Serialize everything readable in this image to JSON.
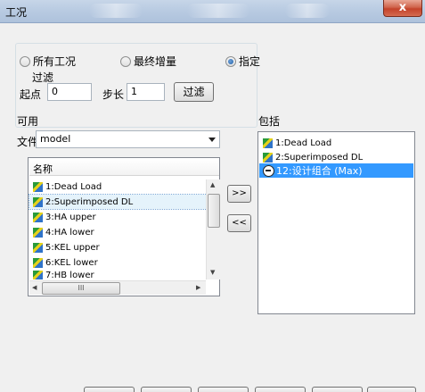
{
  "window": {
    "title": "工况",
    "close_label": "x"
  },
  "scope": {
    "options": [
      "所有工况",
      "最终增量",
      "指定"
    ],
    "selected": "指定"
  },
  "filter": {
    "group_label": "过滤",
    "start_label": "起点",
    "start_value": "0",
    "step_label": "步长",
    "step_value": "1",
    "apply_label": "过滤"
  },
  "available": {
    "heading": "可用",
    "file_label": "文件",
    "file_value": "model",
    "column_header": "名称",
    "items": [
      "1:Dead Load",
      "2:Superimposed DL",
      "3:HA upper",
      "4:HA lower",
      "5:KEL upper",
      "6:KEL lower",
      "7:HB lower"
    ],
    "selected_item": "2:Superimposed DL",
    "scroll_grip": "III"
  },
  "transfer": {
    "add_label": ">>",
    "remove_label": "<<"
  },
  "included": {
    "heading": "包括",
    "items": [
      {
        "label": "1:Dead Load",
        "icon": "loadcase-icon"
      },
      {
        "label": "2:Superimposed DL",
        "icon": "loadcase-icon"
      },
      {
        "label": "12:设计组合 (Max)",
        "icon": "combination-icon"
      }
    ],
    "highlighted_item": "12:设计组合 (Max)"
  },
  "colors": {
    "selection": "#3399ff",
    "close_button": "#c4432a",
    "titlebar": "#b9cbe2"
  }
}
